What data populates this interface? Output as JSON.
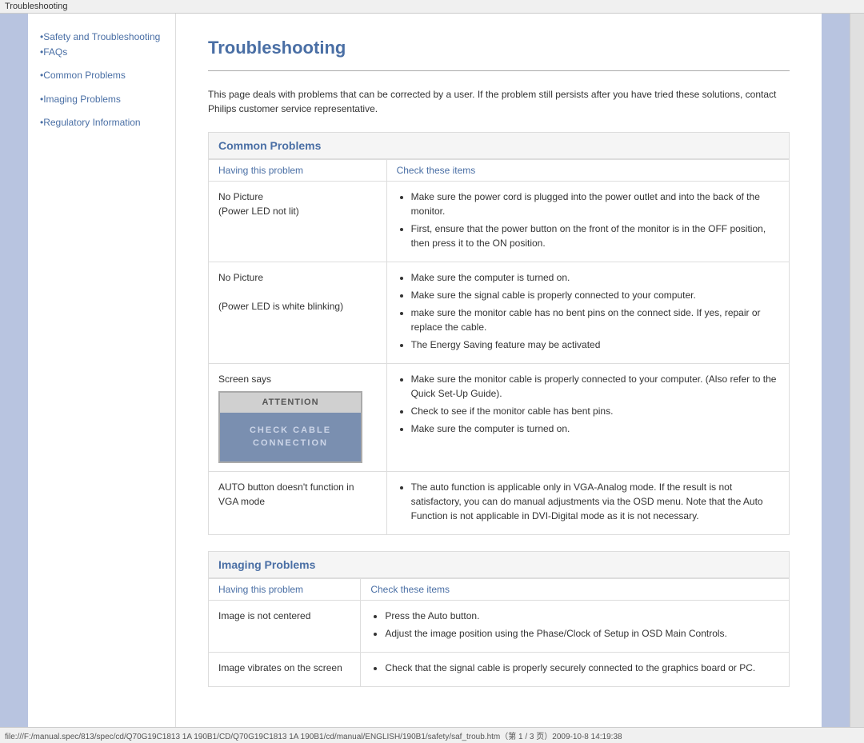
{
  "titleBar": {
    "text": "Troubleshooting"
  },
  "statusBar": {
    "url": "file:///F:/manual.spec/813/spec/cd/Q70G19C1813 1A 190B1/CD/Q70G19C1813 1A 190B1/cd/manual/ENGLISH/190B1/safety/saf_troub.htm（第 1 / 3 页）2009-10-8 14:19:38"
  },
  "sidebar": {
    "links": [
      {
        "label": "•Safety and Troubleshooting"
      },
      {
        "label": "•FAQs"
      },
      {
        "label": "•Common Problems"
      },
      {
        "label": "•Imaging Problems"
      },
      {
        "label": "•Regulatory Information"
      }
    ]
  },
  "page": {
    "title": "Troubleshooting",
    "intro": "This page deals with problems that can be corrected by a user. If the problem still persists after you have tried these solutions, contact Philips customer service representative.",
    "sections": [
      {
        "id": "common-problems",
        "header": "Common Problems",
        "col1Header": "Having this problem",
        "col2Header": "Check these items",
        "rows": [
          {
            "problem": "No Picture\n(Power LED not lit)",
            "solutions": [
              "Make sure the power cord is plugged into the power outlet and into the back of the monitor.",
              "First, ensure that the power button on the front of the monitor is in the OFF position, then press it to the ON position."
            ]
          },
          {
            "problem": "No Picture\n\n(Power LED is white blinking)",
            "solutions": [
              "Make sure the computer is turned on.",
              "Make sure the signal cable is properly connected to your computer.",
              "make sure the monitor cable has no bent pins on the connect side. If yes, repair or replace the cable.",
              "The Energy Saving feature may be activated"
            ]
          },
          {
            "problem": "Screen says",
            "hasAttention": true,
            "attentionHeader": "ATTENTION",
            "attentionBody": "CHECK CABLE CONNECTION",
            "solutions": [
              "Make sure the monitor cable is properly connected to your computer. (Also refer to the Quick Set-Up Guide).",
              "Check to see if the monitor cable has bent pins.",
              "Make sure the computer is turned on."
            ]
          },
          {
            "problem": "AUTO button doesn't function in VGA mode",
            "solutions": [
              "The auto function is applicable only in VGA-Analog mode.  If the result is not satisfactory, you can do manual adjustments via the OSD menu.  Note that the Auto Function is not applicable in DVI-Digital mode as it is not necessary."
            ]
          }
        ]
      },
      {
        "id": "imaging-problems",
        "header": "Imaging Problems",
        "col1Header": "Having this problem",
        "col2Header": "Check these items",
        "rows": [
          {
            "problem": "Image is not centered",
            "solutions": [
              "Press the Auto button.",
              "Adjust the image position using the Phase/Clock of Setup in OSD Main Controls."
            ]
          },
          {
            "problem": "Image vibrates on the screen",
            "solutions": [
              "Check that the signal cable is properly securely connected to the graphics board or PC."
            ]
          }
        ]
      }
    ]
  }
}
